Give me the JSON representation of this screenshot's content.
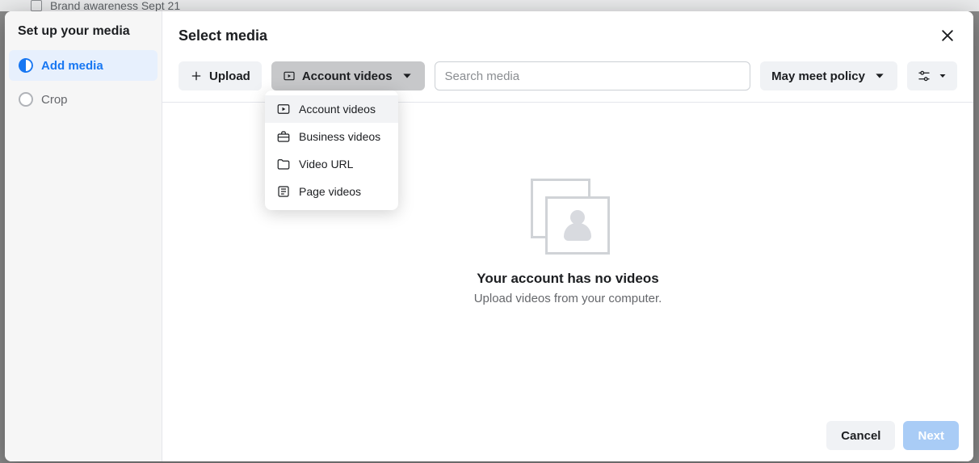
{
  "backdrop": {
    "campaign_name": "Brand awareness Sept 21"
  },
  "sidebar": {
    "title": "Set up your media",
    "items": [
      {
        "label": "Add media",
        "active": true
      },
      {
        "label": "Crop",
        "active": false
      }
    ]
  },
  "main": {
    "title": "Select media"
  },
  "toolbar": {
    "upload_label": "Upload",
    "source_label": "Account videos",
    "search_placeholder": "Search media",
    "policy_label": "May meet policy"
  },
  "dropdown": {
    "items": [
      {
        "label": "Account videos",
        "icon": "video",
        "highlight": true
      },
      {
        "label": "Business videos",
        "icon": "briefcase",
        "highlight": false
      },
      {
        "label": "Video URL",
        "icon": "folder",
        "highlight": false
      },
      {
        "label": "Page videos",
        "icon": "page",
        "highlight": false
      }
    ]
  },
  "empty": {
    "title": "Your account has no videos",
    "subtitle": "Upload videos from your computer."
  },
  "footer": {
    "cancel_label": "Cancel",
    "next_label": "Next"
  }
}
